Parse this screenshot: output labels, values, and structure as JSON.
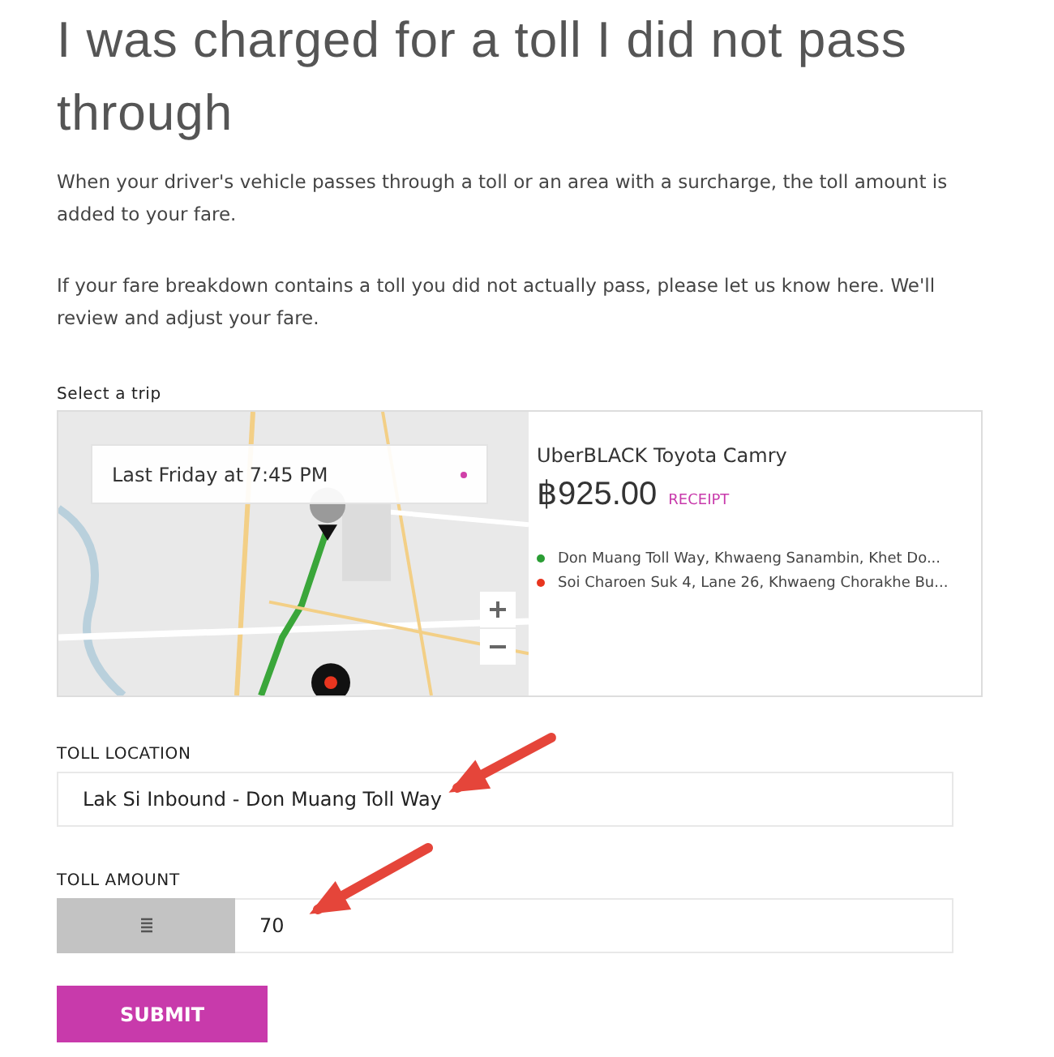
{
  "title": "I was charged for a toll I did not pass through",
  "paragraphs": [
    "When your driver's vehicle passes through a toll or an area with a surcharge, the toll amount is added to your fare.",
    "If your fare breakdown contains a toll you did not actually pass, please let us know here. We'll review and adjust your fare."
  ],
  "trip_select": {
    "label": "Select a trip",
    "dropdown": {
      "value": "Last Friday at 7:45 PM"
    },
    "trip": {
      "vehicle": "UberBLACK Toyota Camry",
      "fare": "฿925.00",
      "receipt_link": "RECEIPT",
      "stops": [
        {
          "address": "Don Muang Toll Way, Khwaeng Sanambin, Khet Do...",
          "color": "#2a9d34"
        },
        {
          "address": "Soi Charoen Suk 4, Lane 26, Khwaeng Chorakhe Bu...",
          "color": "#e8351f"
        }
      ]
    }
  },
  "toll_location": {
    "label": "TOLL LOCATION",
    "value": "Lak Si Inbound - Don Muang Toll Way"
  },
  "toll_amount": {
    "label": "TOLL AMOUNT",
    "value": "70"
  },
  "submit": "SUBMIT",
  "annotations": [
    {
      "kind": "arrow"
    },
    {
      "kind": "arrow"
    }
  ]
}
